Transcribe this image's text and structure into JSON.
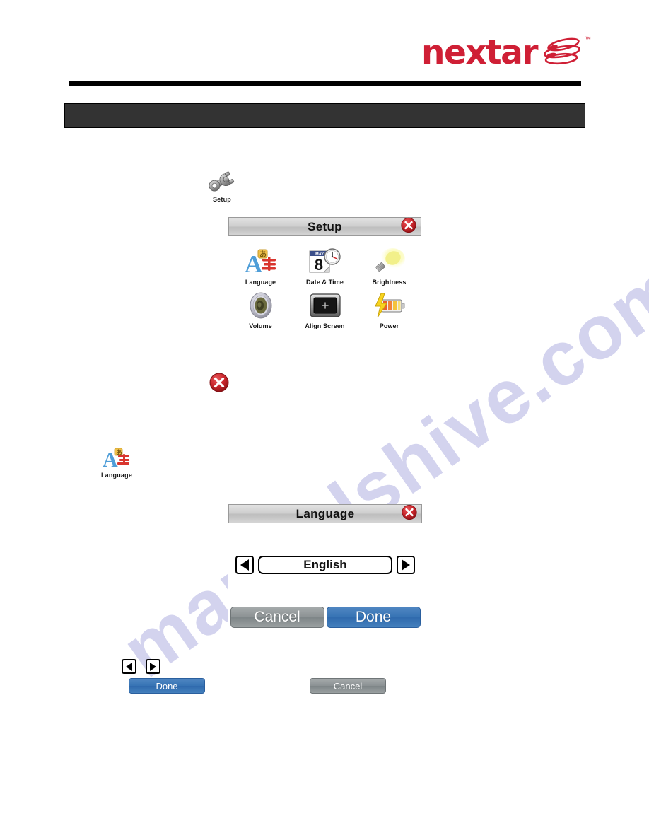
{
  "brand": {
    "wordmark": "nextar",
    "trademark": "™",
    "logo_color": "#cf1f35"
  },
  "section_band": {
    "label": "",
    "background_color": "#333333"
  },
  "watermark": {
    "text": "manualshive.com",
    "color": "#d3d3ee"
  },
  "standalone_icons": {
    "setup": {
      "label": "Setup",
      "icon": "wrench-icon"
    },
    "language": {
      "label": "Language",
      "icon": "language-letters-icon"
    },
    "close": {
      "label": "",
      "icon": "close-circle-icon",
      "color": "#c21b22"
    }
  },
  "setup_dialog": {
    "title": "Setup",
    "close_icon": "close-circle-icon",
    "tiles": [
      {
        "label": "Language",
        "icon": "language-letters-icon"
      },
      {
        "label": "Date & Time",
        "icon": "calendar-clock-icon",
        "calendar_month": "MAY",
        "calendar_day": "8"
      },
      {
        "label": "Brightness",
        "icon": "lightbulb-icon"
      },
      {
        "label": "Volume",
        "icon": "speaker-icon"
      },
      {
        "label": "Align Screen",
        "icon": "align-screen-icon"
      },
      {
        "label": "Power",
        "icon": "battery-bolt-icon"
      }
    ]
  },
  "language_dialog": {
    "title": "Language",
    "close_icon": "close-circle-icon",
    "prev_icon": "triangle-left-icon",
    "next_icon": "triangle-right-icon",
    "selected_value": "English",
    "buttons": {
      "cancel": "Cancel",
      "done": "Done"
    }
  },
  "inline_reference": {
    "prev_icon": "triangle-left-icon",
    "next_icon": "triangle-right-icon",
    "done_label": "Done",
    "cancel_label": "Cancel"
  }
}
